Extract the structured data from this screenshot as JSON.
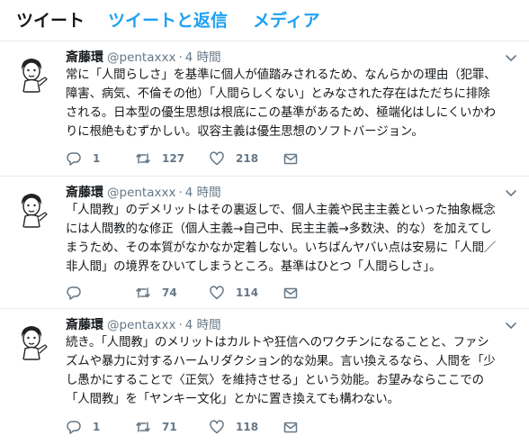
{
  "tabs": [
    {
      "label": "ツイート",
      "active": true
    },
    {
      "label": "ツイートと返信",
      "active": false
    },
    {
      "label": "メディア",
      "active": false
    }
  ],
  "colors": {
    "accent": "#1da1f2",
    "text": "#14171a",
    "muted": "#657786",
    "divider": "#e6ecf0"
  },
  "tweets": [
    {
      "name": "斎藤環",
      "handle": "@pentaxxx",
      "sep": "·",
      "time": "4 時間",
      "text": "常に「人間らしさ」を基準に個人が値踏みされるため、なんらかの理由（犯罪、\n障害、病気、不倫その他）「人間らしくない」とみなされた存在はただちに排除\nされる。日本型の優生思想は根底にこの基準があるため、極端化はしにくいかわ\nりに根絶もむずかしい。収容主義は優生思想のソフトバージョン。",
      "replies": "1",
      "retweets": "127",
      "likes": "218"
    },
    {
      "name": "斎藤環",
      "handle": "@pentaxxx",
      "sep": "·",
      "time": "4 時間",
      "text": "「人間教」のデメリットはその裏返しで、個人主義や民主主義といった抽象概念\nには人間教的な修正（個人主義→自己中、民主主義→多数決、的な）を加えてし\nまうため、その本質がなかなか定着しない。いちばんヤバい点は安易に「人間／\n非人間」の境界をひいてしまうところ。基準はひとつ「人間らしさ」。",
      "replies": "",
      "retweets": "74",
      "likes": "114"
    },
    {
      "name": "斎藤環",
      "handle": "@pentaxxx",
      "sep": "·",
      "time": "4 時間",
      "text": "続き。「人間教」のメリットはカルトや狂信へのワクチンになることと、ファシ\nズムや暴力に対するハームリダクション的な効果。言い換えるなら、人間を「少\nし愚かにすることで〈正気〉を維持させる」という効能。お望みならここでの\n「人間教」を「ヤンキー文化」とかに置き換えても構わない。",
      "replies": "1",
      "retweets": "71",
      "likes": "118"
    }
  ],
  "icons": {
    "avatar": "caricature-avatar",
    "caret": "chevron-down-icon",
    "reply": "reply-icon",
    "retweet": "retweet-icon",
    "like": "heart-icon",
    "dm": "envelope-icon"
  }
}
